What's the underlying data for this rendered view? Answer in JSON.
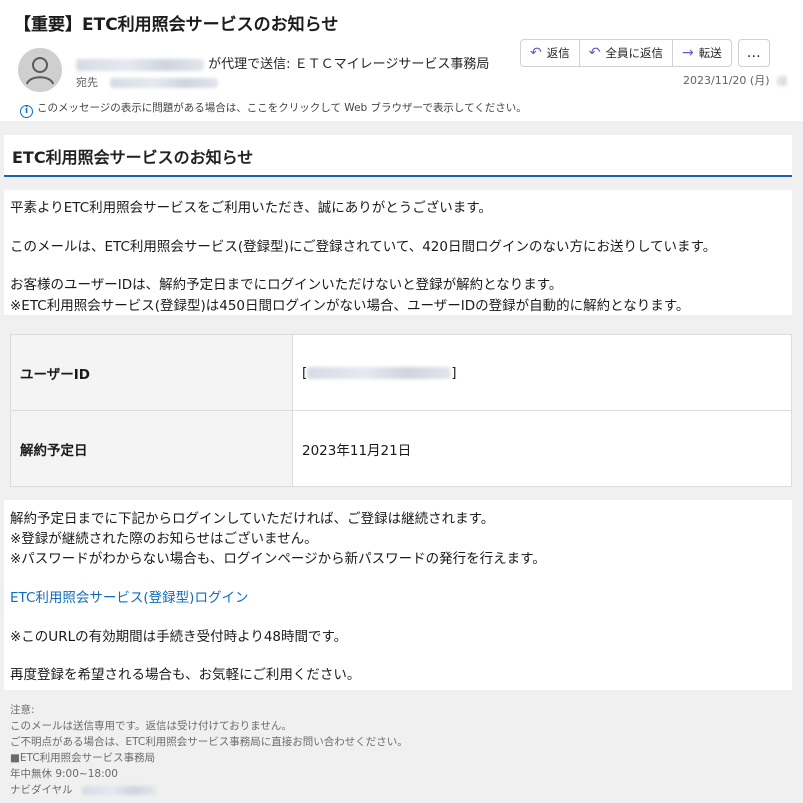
{
  "header": {
    "subject": "【重要】ETC利用照会サービスのお知らせ",
    "sent_on_behalf": "が代理で送信:",
    "sender_name": "ＥＴＣマイレージサービス事務局",
    "to_label": "宛先",
    "info_notice": "このメッセージの表示に問題がある場合は、ここをクリックして Web ブラウザーで表示してください。",
    "date": "2023/11/20 (月)",
    "actions": {
      "reply": "返信",
      "reply_all": "全員に返信",
      "forward": "転送",
      "more": "…"
    }
  },
  "email": {
    "heading": "ETC利用照会サービスのお知らせ",
    "p1": "平素よりETC利用照会サービスをご利用いただき、誠にありがとうございます。",
    "p2": "このメールは、ETC利用照会サービス(登録型)にご登録されていて、420日間ログインのない方にお送りしています。",
    "p3a": "お客様のユーザーIDは、解約予定日までにログインいただけないと登録が解約となります。",
    "p3b": "※ETC利用照会サービス(登録型)は450日間ログインがない場合、ユーザーIDの登録が自動的に解約となります。",
    "table": {
      "user_id_label": "ユーザーID",
      "user_id_open": "[",
      "user_id_close": "]",
      "cancel_date_label": "解約予定日",
      "cancel_date_value": "2023年11月21日"
    },
    "p4a": "解約予定日までに下記からログインしていただければ、ご登録は継続されます。",
    "p4b": "※登録が継続された際のお知らせはございません。",
    "p4c": "※パスワードがわからない場合も、ログインページから新パスワードの発行を行えます。",
    "login_link": "ETC利用照会サービス(登録型)ログイン",
    "p5": "※このURLの有効期間は手続き受付時より48時間です。",
    "p6": "再度登録を希望される場合も、お気軽にご利用ください。",
    "notes": {
      "title": "注意:",
      "line1": "このメールは送信専用です。返信は受け付けておりません。",
      "line2": "ご不明点がある場合は、ETC利用照会サービス事務局に直接お問い合わせください。",
      "line3": "■ETC利用照会サービス事務局",
      "line4": "年中無休 9:00~18:00",
      "line5": "ナビダイヤル"
    }
  },
  "colors": {
    "accent": "#1f5faf",
    "link": "#0f6cbd",
    "action_icon": "#5b5fc7"
  },
  "icons": [
    "avatar-person-icon",
    "info-icon",
    "reply-icon",
    "reply-all-icon",
    "forward-icon",
    "more-icon"
  ]
}
